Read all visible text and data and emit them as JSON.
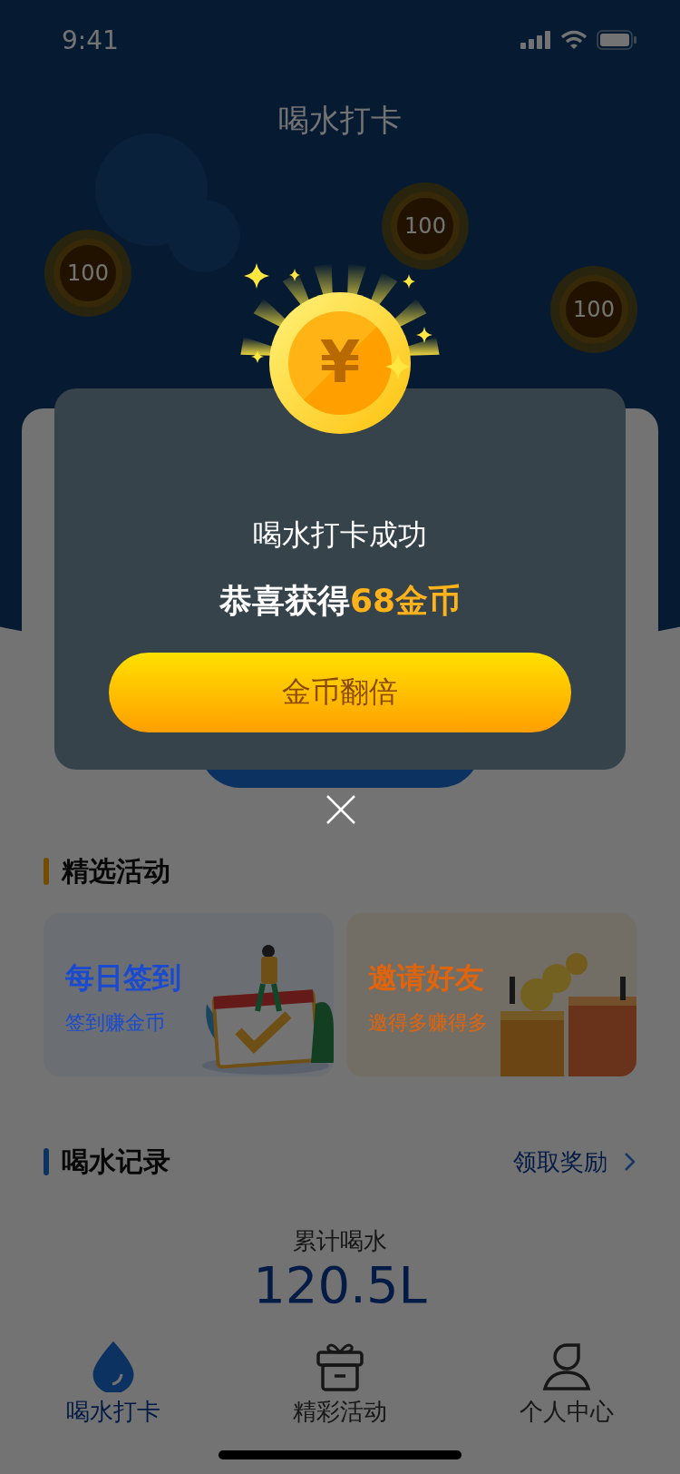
{
  "status_bar": {
    "time": "9:41"
  },
  "header": {
    "title": "喝水打卡",
    "coins": [
      {
        "value": "100"
      },
      {
        "value": "100"
      },
      {
        "value": "100"
      }
    ]
  },
  "featured": {
    "title": "精选活动",
    "cards": [
      {
        "kind": "checkin",
        "title": "每日签到",
        "subtitle": "签到赚金币"
      },
      {
        "kind": "invite",
        "title": "邀请好友",
        "subtitle": "邀得多赚得多"
      }
    ]
  },
  "records": {
    "title": "喝水记录",
    "link": "领取奖励",
    "total_label": "累计喝水",
    "total": "120.5L"
  },
  "tab_bar": [
    {
      "kind": "drop",
      "label": "喝水打卡",
      "selected": true
    },
    {
      "kind": "gift",
      "label": "精彩活动",
      "selected": false
    },
    {
      "kind": "person",
      "label": "个人中心",
      "selected": false
    }
  ],
  "dialog": {
    "coin_symbol": "¥",
    "title": "喝水打卡成功",
    "message_prefix": "恭喜获得",
    "reward": "68金币",
    "button": "金币翻倍"
  }
}
